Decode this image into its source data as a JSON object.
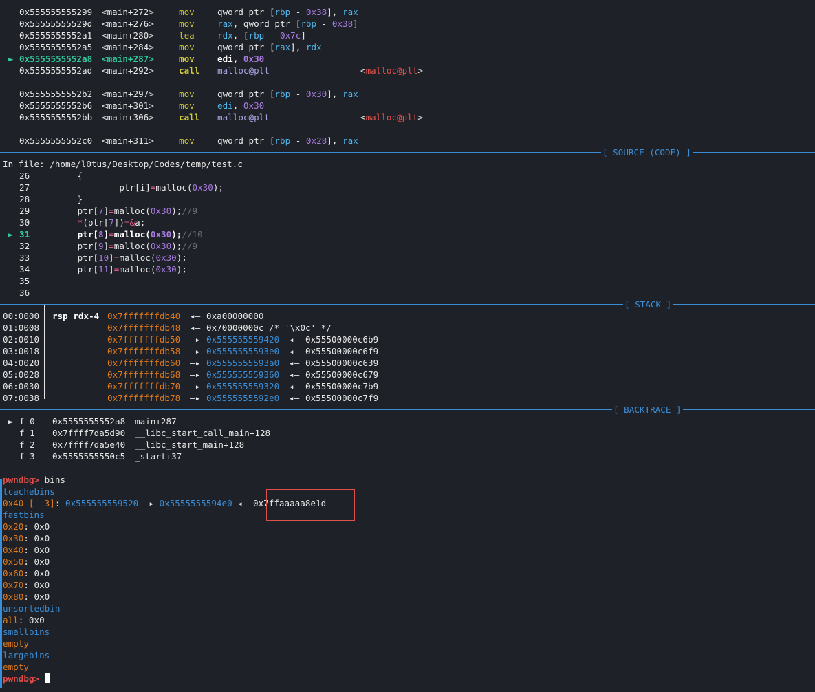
{
  "disasm": [
    {
      "marker": false,
      "addr": "0x555555555299",
      "sym": "<main+272>",
      "mnem": "mov",
      "ops": [
        [
          "qword ptr [",
          "w"
        ],
        [
          "rbp",
          "r"
        ],
        [
          " - ",
          "w"
        ],
        [
          "0x38",
          "p"
        ],
        [
          "], ",
          "w"
        ],
        [
          "rax",
          "r"
        ]
      ]
    },
    {
      "marker": false,
      "addr": "0x55555555529d",
      "sym": "<main+276>",
      "mnem": "mov",
      "ops": [
        [
          "rax",
          "r"
        ],
        [
          ", qword ptr [",
          "w"
        ],
        [
          "rbp",
          "r"
        ],
        [
          " - ",
          "w"
        ],
        [
          "0x38",
          "p"
        ],
        [
          "]",
          "w"
        ]
      ]
    },
    {
      "marker": false,
      "addr": "0x5555555552a1",
      "sym": "<main+280>",
      "mnem": "lea",
      "ops": [
        [
          "rdx",
          "r"
        ],
        [
          ", [",
          "w"
        ],
        [
          "rbp",
          "r"
        ],
        [
          " - ",
          "w"
        ],
        [
          "0x7c",
          "p"
        ],
        [
          "]",
          "w"
        ]
      ]
    },
    {
      "marker": false,
      "addr": "0x5555555552a5",
      "sym": "<main+284>",
      "mnem": "mov",
      "ops": [
        [
          "qword ptr [",
          "w"
        ],
        [
          "rax",
          "r"
        ],
        [
          "], ",
          "w"
        ],
        [
          "rdx",
          "r"
        ]
      ]
    },
    {
      "marker": true,
      "addr": "0x5555555552a8",
      "sym": "<main+287>",
      "mnem": "mov",
      "ops": [
        [
          "edi",
          "b"
        ],
        [
          ", ",
          "b"
        ],
        [
          "0x30",
          "pb"
        ]
      ]
    },
    {
      "marker": false,
      "addr": "0x5555555552ad",
      "sym": "<main+292>",
      "mnem": "call",
      "ops": [
        [
          "malloc@plt",
          "l"
        ]
      ],
      "target": "malloc@plt"
    },
    {
      "blank": true
    },
    {
      "marker": false,
      "addr": "0x5555555552b2",
      "sym": "<main+297>",
      "mnem": "mov",
      "ops": [
        [
          "qword ptr [",
          "w"
        ],
        [
          "rbp",
          "r"
        ],
        [
          " - ",
          "w"
        ],
        [
          "0x30",
          "p"
        ],
        [
          "], ",
          "w"
        ],
        [
          "rax",
          "r"
        ]
      ]
    },
    {
      "marker": false,
      "addr": "0x5555555552b6",
      "sym": "<main+301>",
      "mnem": "mov",
      "ops": [
        [
          "edi",
          "r"
        ],
        [
          ", ",
          "w"
        ],
        [
          "0x30",
          "p"
        ]
      ]
    },
    {
      "marker": false,
      "addr": "0x5555555552bb",
      "sym": "<main+306>",
      "mnem": "call",
      "ops": [
        [
          "malloc@plt",
          "l"
        ]
      ],
      "target": "malloc@plt"
    },
    {
      "blank": true
    },
    {
      "marker": false,
      "addr": "0x5555555552c0",
      "sym": "<main+311>",
      "mnem": "mov",
      "ops": [
        [
          "qword ptr [",
          "w"
        ],
        [
          "rbp",
          "r"
        ],
        [
          " - ",
          "w"
        ],
        [
          "0x28",
          "p"
        ],
        [
          "], ",
          "w"
        ],
        [
          "rax",
          "r"
        ]
      ]
    }
  ],
  "sections": {
    "source": "[ SOURCE (CODE) ]",
    "stack": "[ STACK ]",
    "backtrace": "[ BACKTRACE ]"
  },
  "source": {
    "file_line": "In file: /home/l0tus/Desktop/Codes/temp/test.c",
    "lines": [
      {
        "num": "26",
        "current": false,
        "parts": [
          [
            "        {",
            "w"
          ]
        ]
      },
      {
        "num": "27",
        "current": false,
        "parts": [
          [
            "                ptr[i]",
            "w"
          ],
          [
            "=",
            "k"
          ],
          [
            "malloc(",
            "w"
          ],
          [
            "0x30",
            "p"
          ],
          [
            ");",
            "w"
          ]
        ]
      },
      {
        "num": "28",
        "current": false,
        "parts": [
          [
            "        }",
            "w"
          ]
        ]
      },
      {
        "num": "29",
        "current": false,
        "parts": [
          [
            "        ptr[",
            "w"
          ],
          [
            "7",
            "p"
          ],
          [
            "]",
            "w"
          ],
          [
            "=",
            "k"
          ],
          [
            "malloc(",
            "w"
          ],
          [
            "0x30",
            "p"
          ],
          [
            ");",
            "w"
          ],
          [
            "//9",
            "g"
          ]
        ]
      },
      {
        "num": "30",
        "current": false,
        "parts": [
          [
            "        ",
            "w"
          ],
          [
            "*",
            "k"
          ],
          [
            "(ptr[",
            "w"
          ],
          [
            "7",
            "p"
          ],
          [
            "])",
            "w"
          ],
          [
            "=&",
            "k"
          ],
          [
            "a;",
            "w"
          ]
        ]
      },
      {
        "num": "31",
        "current": true,
        "parts": [
          [
            "        ptr[",
            "b"
          ],
          [
            "8",
            "pb"
          ],
          [
            "]",
            "b"
          ],
          [
            "=",
            "k"
          ],
          [
            "malloc(",
            "b"
          ],
          [
            "0x30",
            "pb"
          ],
          [
            ");",
            "b"
          ],
          [
            "//10",
            "g"
          ]
        ]
      },
      {
        "num": "32",
        "current": false,
        "parts": [
          [
            "        ptr[",
            "w"
          ],
          [
            "9",
            "p"
          ],
          [
            "]",
            "w"
          ],
          [
            "=",
            "k"
          ],
          [
            "malloc(",
            "w"
          ],
          [
            "0x30",
            "p"
          ],
          [
            ");",
            "w"
          ],
          [
            "//9",
            "g"
          ]
        ]
      },
      {
        "num": "33",
        "current": false,
        "parts": [
          [
            "        ptr[",
            "w"
          ],
          [
            "10",
            "p"
          ],
          [
            "]",
            "w"
          ],
          [
            "=",
            "k"
          ],
          [
            "malloc(",
            "w"
          ],
          [
            "0x30",
            "p"
          ],
          [
            ");",
            "w"
          ]
        ]
      },
      {
        "num": "34",
        "current": false,
        "parts": [
          [
            "        ptr[",
            "w"
          ],
          [
            "11",
            "p"
          ],
          [
            "]",
            "w"
          ],
          [
            "=",
            "k"
          ],
          [
            "malloc(",
            "w"
          ],
          [
            "0x30",
            "p"
          ],
          [
            ");",
            "w"
          ]
        ]
      },
      {
        "num": "35",
        "current": false,
        "parts": []
      },
      {
        "num": "36",
        "current": false,
        "parts": []
      }
    ]
  },
  "stack": [
    {
      "idx": "00:0000",
      "regs": "rsp rdx-4",
      "addr": "0x7fffffffdb40",
      "arrow": "◂—",
      "ptr": "",
      "val": "0xa00000000"
    },
    {
      "idx": "01:0008",
      "regs": "",
      "addr": "0x7fffffffdb48",
      "arrow": "◂—",
      "ptr": "",
      "val": "0x70000000c /* '\\x0c' */"
    },
    {
      "idx": "02:0010",
      "regs": "",
      "addr": "0x7fffffffdb50",
      "arrow": "—▸",
      "ptr": "0x555555559420",
      "val": "0x55500000c6b9"
    },
    {
      "idx": "03:0018",
      "regs": "",
      "addr": "0x7fffffffdb58",
      "arrow": "—▸",
      "ptr": "0x5555555593e0",
      "val": "0x55500000c6f9"
    },
    {
      "idx": "04:0020",
      "regs": "",
      "addr": "0x7fffffffdb60",
      "arrow": "—▸",
      "ptr": "0x5555555593a0",
      "val": "0x55500000c639"
    },
    {
      "idx": "05:0028",
      "regs": "",
      "addr": "0x7fffffffdb68",
      "arrow": "—▸",
      "ptr": "0x555555559360",
      "val": "0x55500000c679"
    },
    {
      "idx": "06:0030",
      "regs": "",
      "addr": "0x7fffffffdb70",
      "arrow": "—▸",
      "ptr": "0x555555559320",
      "val": "0x55500000c7b9"
    },
    {
      "idx": "07:0038",
      "regs": "",
      "addr": "0x7fffffffdb78",
      "arrow": "—▸",
      "ptr": "0x5555555592e0",
      "val": "0x55500000c7f9"
    }
  ],
  "backtrace": [
    {
      "marker": true,
      "frame": "f 0",
      "addr": "0x5555555552a8",
      "sym": "main+287"
    },
    {
      "marker": false,
      "frame": "f 1",
      "addr": "0x7ffff7da5d90",
      "sym": "__libc_start_call_main+128"
    },
    {
      "marker": false,
      "frame": "f 2",
      "addr": "0x7ffff7da5e40",
      "sym": "__libc_start_main+128"
    },
    {
      "marker": false,
      "frame": "f 3",
      "addr": "0x5555555550c5",
      "sym": "_start+37"
    }
  ],
  "bins": {
    "prompt": "pwndbg>",
    "command": "bins",
    "tcache_title": "tcachebins",
    "tcache_entry": {
      "size": "0x40",
      "count": " [  3]",
      "sep": ": ",
      "p1": "0x555555559520",
      "arrow1": " —▸ ",
      "p2": "0x5555555594e0",
      "arrow2": " ◂— ",
      "p3": "0x7ffaaaaa8e1d"
    },
    "fastbins_title": "fastbins",
    "fastbins": [
      {
        "size": "0x20",
        "val": "0x0"
      },
      {
        "size": "0x30",
        "val": "0x0"
      },
      {
        "size": "0x40",
        "val": "0x0"
      },
      {
        "size": "0x50",
        "val": "0x0"
      },
      {
        "size": "0x60",
        "val": "0x0"
      },
      {
        "size": "0x70",
        "val": "0x0"
      },
      {
        "size": "0x80",
        "val": "0x0"
      }
    ],
    "unsorted_title": "unsortedbin",
    "unsorted_all_label": "all",
    "unsorted_all_val": "0x0",
    "smallbins_title": "smallbins",
    "smallbins_val": "empty",
    "largebins_title": "largebins",
    "largebins_val": "empty"
  },
  "ui": {
    "marker_glyph": "►"
  }
}
